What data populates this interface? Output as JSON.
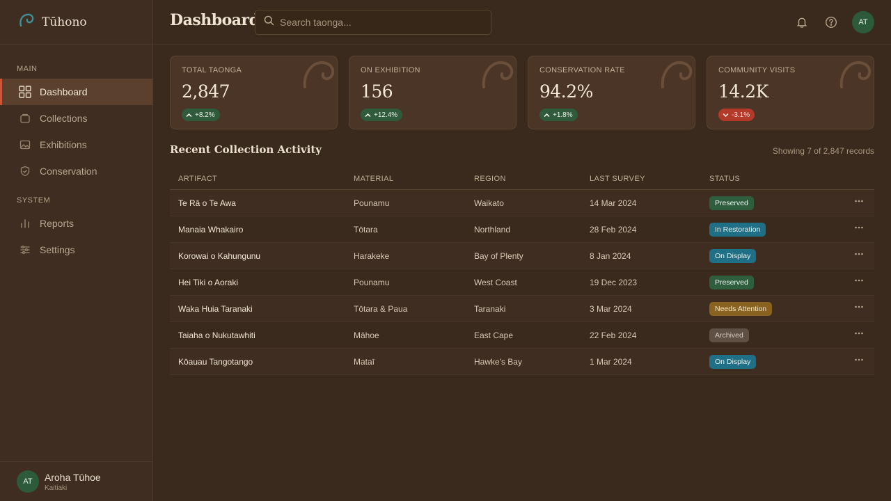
{
  "app": {
    "name": "Tūhono"
  },
  "sidebar": {
    "sections": [
      {
        "label": "MAIN",
        "items": [
          {
            "label": "Dashboard",
            "icon": "grid-icon",
            "active": true
          },
          {
            "label": "Collections",
            "icon": "box-icon",
            "active": false
          },
          {
            "label": "Exhibitions",
            "icon": "image-icon",
            "active": false
          },
          {
            "label": "Conservation",
            "icon": "shield-check-icon",
            "active": false
          }
        ]
      },
      {
        "label": "SYSTEM",
        "items": [
          {
            "label": "Reports",
            "icon": "bar-chart-icon",
            "active": false
          },
          {
            "label": "Settings",
            "icon": "sliders-icon",
            "active": false
          }
        ]
      }
    ],
    "user": {
      "initials": "AT",
      "name": "Aroha Tūhoe",
      "role": "Kaitiaki"
    }
  },
  "header": {
    "title": "Dashboard",
    "search_placeholder": "Search taonga...",
    "avatar_initials": "AT"
  },
  "stats": [
    {
      "label": "TOTAL TAONGA",
      "value": "2,847",
      "change": "+8.2%",
      "direction": "up"
    },
    {
      "label": "ON EXHIBITION",
      "value": "156",
      "change": "+12.4%",
      "direction": "up"
    },
    {
      "label": "CONSERVATION RATE",
      "value": "94.2%",
      "change": "+1.8%",
      "direction": "up"
    },
    {
      "label": "COMMUNITY VISITS",
      "value": "14.2K",
      "change": "-3.1%",
      "direction": "down"
    }
  ],
  "activity": {
    "title": "Recent Collection Activity",
    "records_info": "Showing 7 of 2,847 records",
    "columns": [
      "ARTIFACT",
      "MATERIAL",
      "REGION",
      "LAST SURVEY",
      "STATUS"
    ],
    "rows": [
      {
        "artifact": "Te Rā o Te Awa",
        "material": "Pounamu",
        "region": "Waikato",
        "last_survey": "14 Mar 2024",
        "status": "Preserved"
      },
      {
        "artifact": "Manaia Whakairo",
        "material": "Tōtara",
        "region": "Northland",
        "last_survey": "28 Feb 2024",
        "status": "In Restoration"
      },
      {
        "artifact": "Korowai o Kahungunu",
        "material": "Harakeke",
        "region": "Bay of Plenty",
        "last_survey": "8 Jan 2024",
        "status": "On Display"
      },
      {
        "artifact": "Hei Tiki o Aoraki",
        "material": "Pounamu",
        "region": "West Coast",
        "last_survey": "19 Dec 2023",
        "status": "Preserved"
      },
      {
        "artifact": "Waka Huia Taranaki",
        "material": "Tōtara & Paua",
        "region": "Taranaki",
        "last_survey": "3 Mar 2024",
        "status": "Needs Attention"
      },
      {
        "artifact": "Taiaha o Nukutawhiti",
        "material": "Māhoe",
        "region": "East Cape",
        "last_survey": "22 Feb 2024",
        "status": "Archived"
      },
      {
        "artifact": "Kōauau Tangotango",
        "material": "Mataī",
        "region": "Hawke's Bay",
        "last_survey": "1 Mar 2024",
        "status": "On Display"
      }
    ]
  },
  "colors": {
    "accent": "#c9553a",
    "status": {
      "Preserved": "#2f5e3e",
      "In Restoration": "#1f6f86",
      "On Display": "#1f6f86",
      "Needs Attention": "#8a6220",
      "Archived": "#5e5045"
    }
  }
}
